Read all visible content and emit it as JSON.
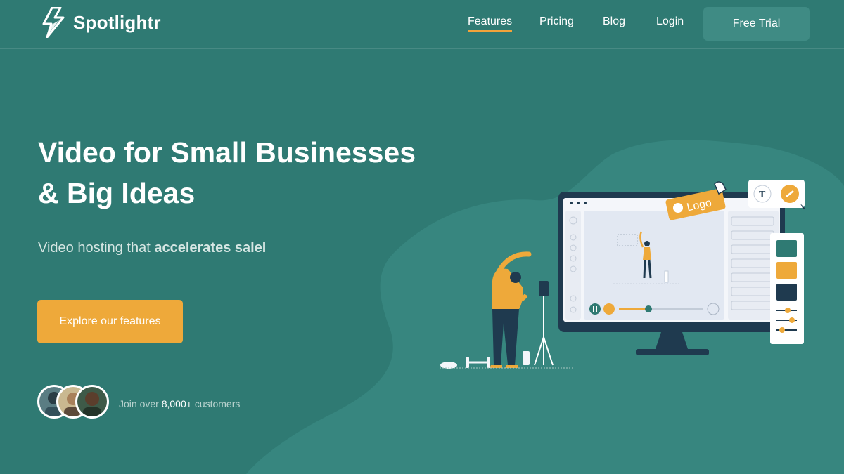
{
  "brand": {
    "name": "Spotlightr",
    "logo_icon": "lightning-bolt-icon"
  },
  "nav": {
    "links": [
      {
        "label": "Features",
        "active": true
      },
      {
        "label": "Pricing",
        "active": false
      },
      {
        "label": "Blog",
        "active": false
      },
      {
        "label": "Login",
        "active": false
      }
    ],
    "trial_label": "Free Trial"
  },
  "hero": {
    "headline_line1": "Video for Small Businesses",
    "headline_line2": "& Big Ideas",
    "sub_prefix": "Video hosting that",
    "sub_bold": "accelerates salel",
    "cta_label": "Explore our features"
  },
  "social_proof": {
    "prefix": "Join over",
    "count": "8,000+",
    "suffix": "customers"
  },
  "illustration": {
    "logo_tag": "Logo",
    "text_tool": "T",
    "swatches": [
      "#2f7a73",
      "#eea93a",
      "#1f3a4f"
    ]
  },
  "colors": {
    "background": "#2f7a73",
    "accent": "#eea93a",
    "button_trial": "#3f8b84",
    "dark": "#1f3a4f"
  }
}
